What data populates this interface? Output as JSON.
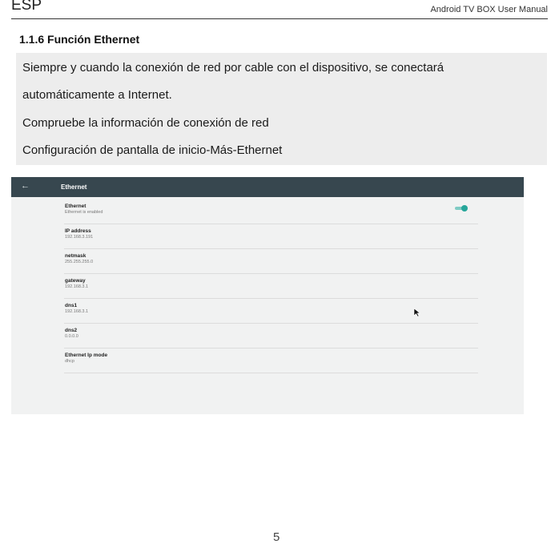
{
  "header": {
    "lang": "ESP",
    "manual": "Android  TV  BOX  User  Manual"
  },
  "section": {
    "title": "1.1.6 Función Ethernet",
    "lines": [
      "Siempre y cuando la conexión de red por cable con el dispositivo, se conectará",
      "automáticamente a Internet.",
      "Compruebe la información de conexión de red",
      "Configuración de pantalla de inicio-Más-Ethernet"
    ]
  },
  "screenshot": {
    "title": "Ethernet",
    "back_icon": "arrow-left-icon",
    "toggle_on": true,
    "accent": "#26a69a",
    "rows": [
      {
        "title": "Ethernet",
        "sub": "Ethernet is enabled"
      },
      {
        "title": "IP address",
        "sub": "192.168.3.191"
      },
      {
        "title": "netmask",
        "sub": "255.255.255.0"
      },
      {
        "title": "gateway",
        "sub": "192.168.3.1"
      },
      {
        "title": "dns1",
        "sub": "192.168.3.1"
      },
      {
        "title": "dns2",
        "sub": "0.0.0.0"
      },
      {
        "title": "Ethernet Ip mode",
        "sub": "dhcp"
      }
    ]
  },
  "page_number": "5"
}
